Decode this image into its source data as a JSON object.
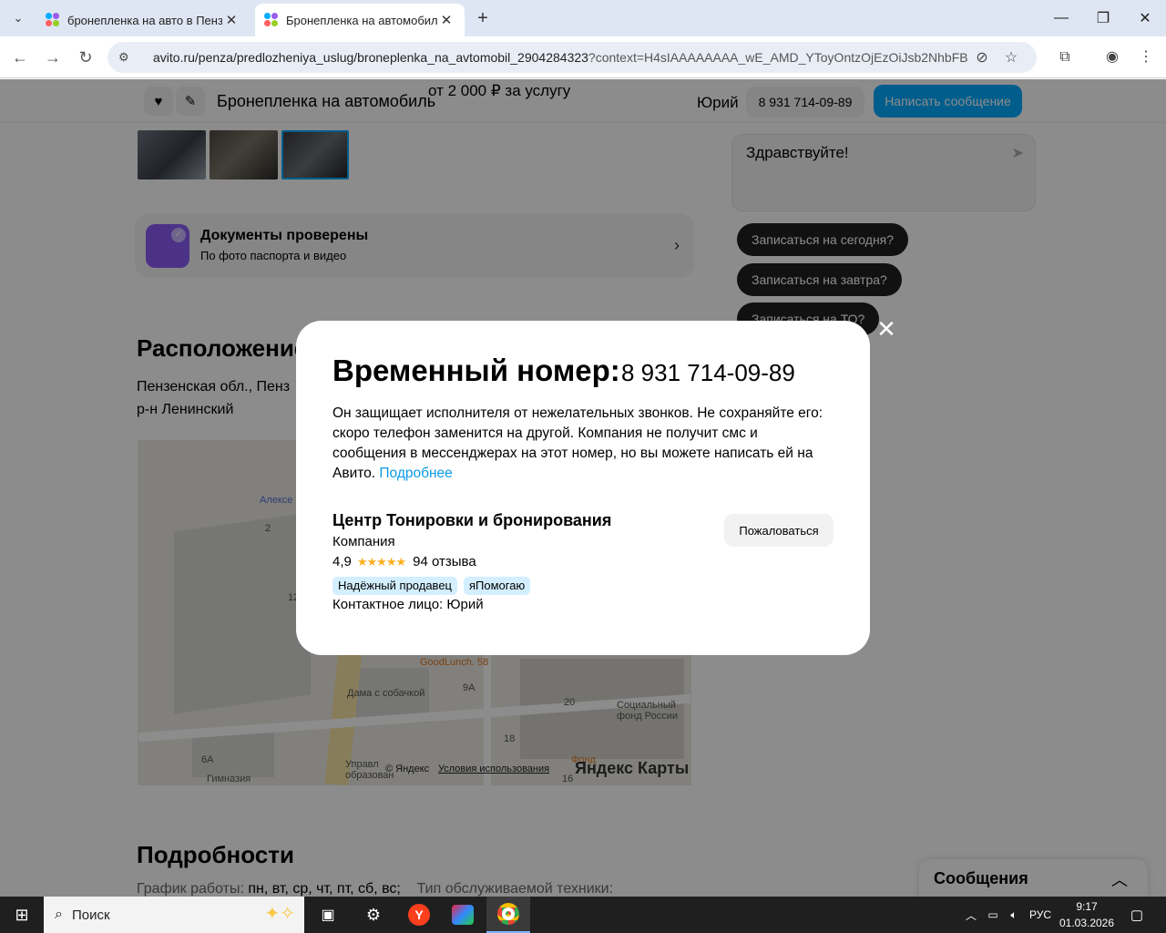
{
  "browser": {
    "tabs": [
      {
        "title": "бронепленка на авто в Пензе",
        "active": false
      },
      {
        "title": "Бронепленка на автомобиль в",
        "active": true
      }
    ],
    "url_main": "avito.ru/penza/predlozheniya_uslug/broneplenka_na_avtomobil_2904284323",
    "url_rest": "?context=H4sIAAAAAAAA_wE_AMD_YToyOntzOjEzOiJsb2NhbFByaW..."
  },
  "sticky": {
    "title": "Бронепленка на автомобиль",
    "price": "от 2 000 ₽ за услугу",
    "seller": "Юрий",
    "phone": "8 931 714-09-89",
    "write": "Написать сообщение"
  },
  "docs": {
    "title": "Документы проверены",
    "subtitle": "По фото паспорта и видео"
  },
  "location": {
    "heading": "Расположение",
    "line1": "Пензенская обл., Пенз",
    "line2": "р-н Ленинский"
  },
  "map": {
    "labels": [
      "Алексе",
      "2",
      "12",
      "GoodLunch. 58",
      "9А",
      "Дама с собачкой",
      "20",
      "Социальный фонд России",
      "18",
      "6А",
      "Гимназия",
      "Управл образован",
      "Фонд",
      "16"
    ],
    "copyright": "© Яндекс",
    "terms": "Условия использования",
    "brand": "Яндекс Карты"
  },
  "chat": {
    "greeting": "Здравствуйте!",
    "suggestions": [
      "Записаться на сегодня?",
      "Записаться на завтра?",
      "Записаться на ТО?"
    ]
  },
  "details": {
    "heading": "Подробности",
    "schedule_label": "График работы:",
    "schedule_value": "пн, вт, ср, чт, пт, сб, вс;",
    "tech_label": "Тип обслуживаемой техники:"
  },
  "messages_dock": {
    "title": "Сообщения"
  },
  "modal": {
    "heading": "Временный номер:",
    "number": "8 931 714-09-89",
    "description": "Он защищает исполнителя от нежелательных звонков. Не сохраняйте его: скоро телефон заменится на другой. Компания не получит смс и сообщения в мессенджерах на этот номер, но вы можете написать ей на Авито.",
    "more_link": "Подробнее",
    "company": "Центр Тонировки и бронирования",
    "company_type": "Компания",
    "rating": "4,9",
    "stars": 5,
    "reviews": "94 отзыва",
    "badges": [
      "Надёжный продавец",
      "яПомогаю"
    ],
    "contact": "Контактное лицо: Юрий",
    "report": "Пожаловаться"
  },
  "taskbar": {
    "search": "Поиск",
    "lang": "РУС",
    "time": "9:17",
    "date": "01.03.2026"
  },
  "colors": {
    "accent": "#00aaff",
    "link": "#0a9ae8",
    "badge": "#d3efff",
    "stars": "#ffb021",
    "pill": "#1f1f1f"
  }
}
